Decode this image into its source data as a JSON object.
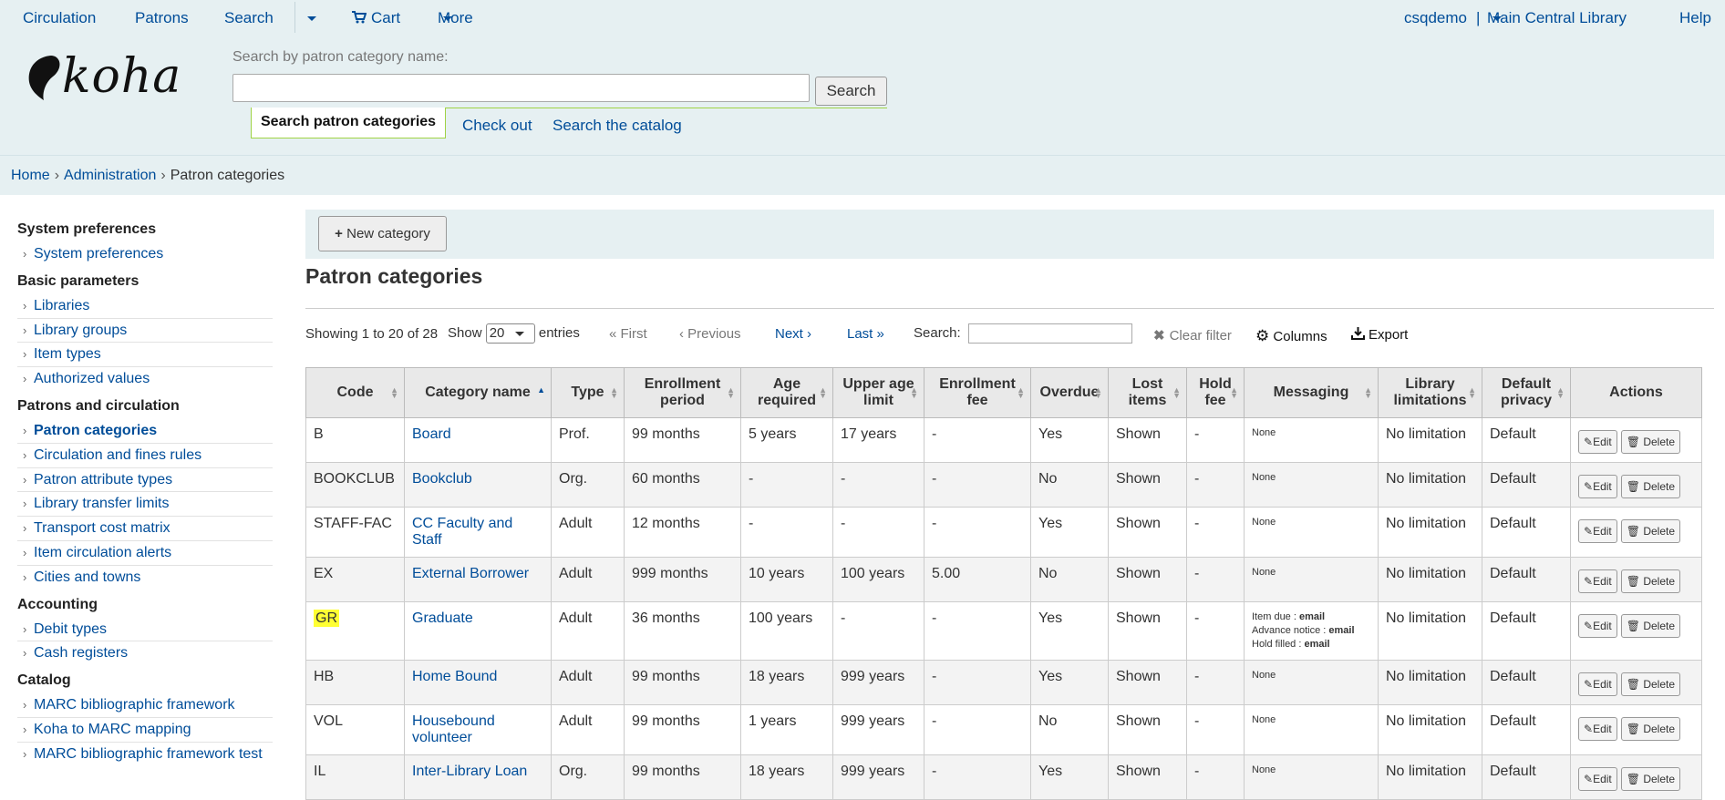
{
  "topnav": {
    "circulation": "Circulation",
    "patrons": "Patrons",
    "search": "Search",
    "cart": "Cart",
    "more": "More",
    "user": "csqdemo",
    "separator": "|",
    "library": "Main Central Library",
    "help": "Help"
  },
  "logo": {
    "text": "koha"
  },
  "search": {
    "label": "Search by patron category name:",
    "value": "",
    "button": "Search",
    "tabs": [
      "Search patron categories",
      "Check out",
      "Search the catalog"
    ]
  },
  "breadcrumb": {
    "home": "Home",
    "admin": "Administration",
    "current": "Patron categories"
  },
  "sidebar": [
    {
      "heading": "System preferences",
      "items": [
        "System preferences"
      ]
    },
    {
      "heading": "Basic parameters",
      "items": [
        "Libraries",
        "Library groups",
        "Item types",
        "Authorized values"
      ]
    },
    {
      "heading": "Patrons and circulation",
      "items": [
        "Patron categories",
        "Circulation and fines rules",
        "Patron attribute types",
        "Library transfer limits",
        "Transport cost matrix",
        "Item circulation alerts",
        "Cities and towns"
      ]
    },
    {
      "heading": "Accounting",
      "items": [
        "Debit types",
        "Cash registers"
      ]
    },
    {
      "heading": "Catalog",
      "items": [
        "MARC bibliographic framework",
        "Koha to MARC mapping",
        "MARC bibliographic framework test"
      ]
    }
  ],
  "toolbar": {
    "new_category": "New category"
  },
  "page_title": "Patron categories",
  "controls": {
    "info": "Showing 1 to 20 of 28",
    "show": "Show",
    "length": "20",
    "entries": "entries",
    "first": "First",
    "previous": "Previous",
    "next": "Next",
    "last": "Last",
    "search_label": "Search:",
    "clear_filter": "Clear filter",
    "columns": "Columns",
    "export": "Export"
  },
  "table": {
    "headers": [
      "Code",
      "Category name",
      "Type",
      "Enrollment period",
      "Age required",
      "Upper age limit",
      "Enrollment fee",
      "Overdue",
      "Lost items",
      "Hold fee",
      "Messaging",
      "Library limitations",
      "Default privacy",
      "Actions"
    ],
    "edit": "Edit",
    "delete": "Delete",
    "rows": [
      {
        "code": "B",
        "name": "Board",
        "type": "Prof.",
        "enrollment": "99 months",
        "age": "5 years",
        "upper": "17 years",
        "fee": "-",
        "overdue": "Yes",
        "lost": "Shown",
        "hold": "-",
        "messaging": [
          "None"
        ],
        "limit": "No limitation",
        "privacy": "Default"
      },
      {
        "code": "BOOKCLUB",
        "name": "Bookclub",
        "type": "Org.",
        "enrollment": "60 months",
        "age": "-",
        "upper": "-",
        "fee": "-",
        "overdue": "No",
        "lost": "Shown",
        "hold": "-",
        "messaging": [
          "None"
        ],
        "limit": "No limitation",
        "privacy": "Default"
      },
      {
        "code": "STAFF-FAC",
        "name": "CC Faculty and Staff",
        "type": "Adult",
        "enrollment": "12 months",
        "age": "-",
        "upper": "-",
        "fee": "-",
        "overdue": "Yes",
        "lost": "Shown",
        "hold": "-",
        "messaging": [
          "None"
        ],
        "limit": "No limitation",
        "privacy": "Default"
      },
      {
        "code": "EX",
        "name": "External Borrower",
        "type": "Adult",
        "enrollment": "999 months",
        "age": "10 years",
        "upper": "100 years",
        "fee": "5.00",
        "overdue": "No",
        "lost": "Shown",
        "hold": "-",
        "messaging": [
          "None"
        ],
        "limit": "No limitation",
        "privacy": "Default"
      },
      {
        "code": "GR",
        "name": "Graduate",
        "type": "Adult",
        "enrollment": "36 months",
        "age": "100 years",
        "upper": "-",
        "fee": "-",
        "overdue": "Yes",
        "lost": "Shown",
        "hold": "-",
        "messaging": [
          {
            "label": "Item due : ",
            "value": "email"
          },
          {
            "label": "Advance notice : ",
            "value": "email"
          },
          {
            "label": "Hold filled : ",
            "value": "email"
          }
        ],
        "limit": "No limitation",
        "privacy": "Default",
        "highlight": true
      },
      {
        "code": "HB",
        "name": "Home Bound",
        "type": "Adult",
        "enrollment": "99 months",
        "age": "18 years",
        "upper": "999 years",
        "fee": "-",
        "overdue": "Yes",
        "lost": "Shown",
        "hold": "-",
        "messaging": [
          "None"
        ],
        "limit": "No limitation",
        "privacy": "Default"
      },
      {
        "code": "VOL",
        "name": "Housebound volunteer",
        "type": "Adult",
        "enrollment": "99 months",
        "age": "1 years",
        "upper": "999 years",
        "fee": "-",
        "overdue": "No",
        "lost": "Shown",
        "hold": "-",
        "messaging": [
          "None"
        ],
        "limit": "No limitation",
        "privacy": "Default"
      },
      {
        "code": "IL",
        "name": "Inter-Library Loan",
        "type": "Org.",
        "enrollment": "99 months",
        "age": "18 years",
        "upper": "999 years",
        "fee": "-",
        "overdue": "Yes",
        "lost": "Shown",
        "hold": "-",
        "messaging": [
          "None"
        ],
        "limit": "No limitation",
        "privacy": "Default"
      }
    ]
  }
}
